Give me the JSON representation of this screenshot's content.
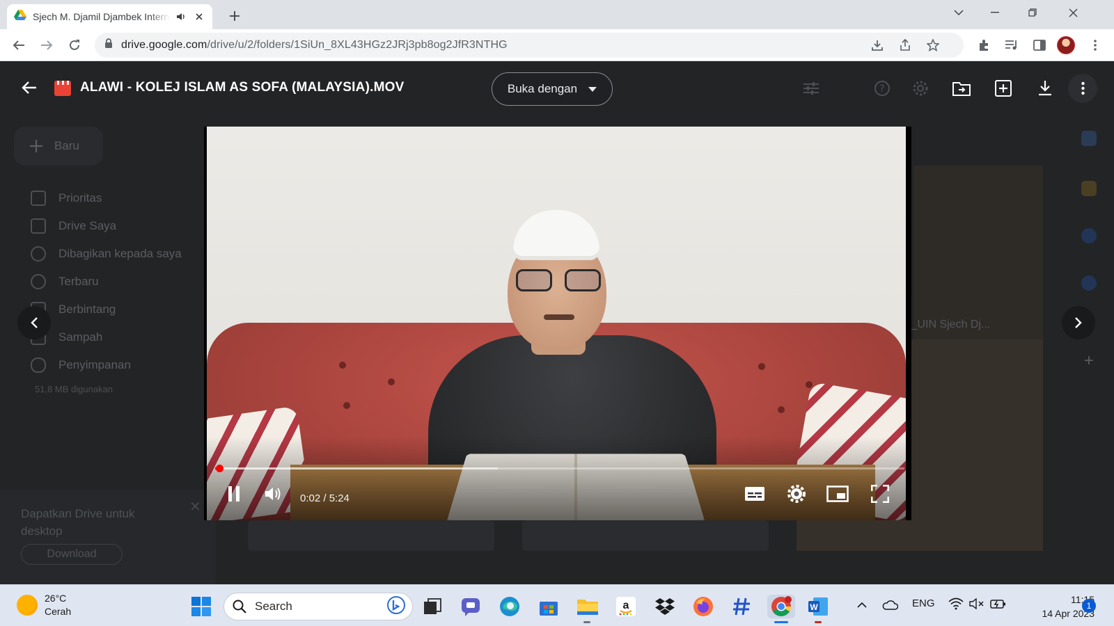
{
  "browser": {
    "tab_title": "Sjech M. Djamil Djambek Internasional",
    "url_host": "drive.google.com",
    "url_path": "/drive/u/2/folders/1SiUn_8XL43HGz2JRj3pb8og2JfR3NTHG"
  },
  "drive_background": {
    "new_button": "Baru",
    "sidebar": [
      "Prioritas",
      "Drive Saya",
      "Dibagikan kepada saya",
      "Terbaru",
      "Berbintang",
      "Sampah",
      "Penyimpanan"
    ],
    "storage": "51,8 MB digunakan",
    "promo_text": "Dapatkan Drive untuk desktop",
    "promo_button": "Download",
    "partial_filename": "i_UIN Sjech Dj..."
  },
  "viewer": {
    "file_title": "ALAWI - KOLEJ ISLAM AS SOFA (MALAYSIA).MOV",
    "open_with": "Buka dengan"
  },
  "player": {
    "current_time": "0:02",
    "duration": "5:24",
    "time_display": "0:02 / 5:24",
    "progress_fraction": 0.006,
    "buffered_fraction": 0.41
  },
  "taskbar": {
    "temperature": "26°C",
    "weather": "Cerah",
    "search_placeholder": "Search",
    "language": "ENG",
    "time": "11:15",
    "date": "14 Apr 2023",
    "notification_count": "1"
  },
  "colors": {
    "progress": "#ff0000",
    "drive_bg": "#202124",
    "taskbar": "#dfe6f1"
  }
}
